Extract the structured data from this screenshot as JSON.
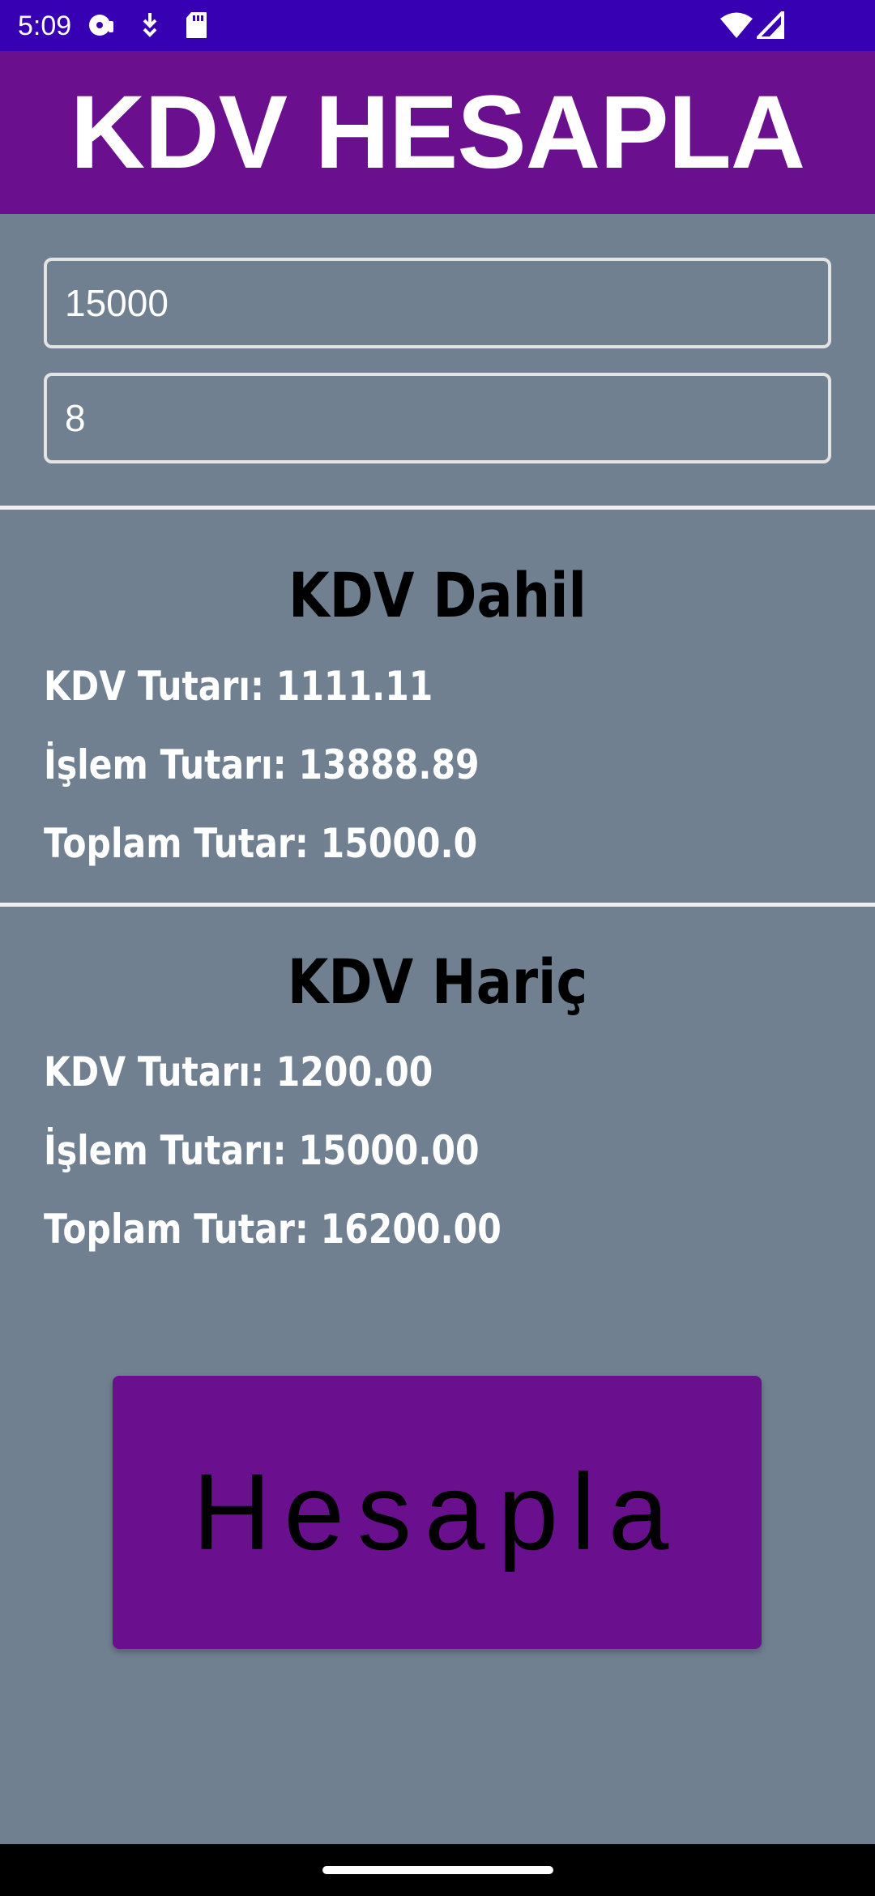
{
  "status_bar": {
    "time": "5:09",
    "icons": [
      "media-icon",
      "download-icon",
      "sd-card-icon",
      "wifi-icon",
      "signal-icon"
    ]
  },
  "app_bar": {
    "title": "KDV HESAPLA",
    "color": "#6A0F8E"
  },
  "inputs": {
    "amount_value": "15000",
    "rate_value": "8"
  },
  "kdv_dahil": {
    "title": "KDV Dahil",
    "kdv_amount": "KDV Tutarı: 1111.11",
    "transaction_amount": "İşlem Tutarı: 13888.89",
    "total_amount": "Toplam Tutar: 15000.0"
  },
  "kdv_haric": {
    "title": "KDV Hariç",
    "kdv_amount": "KDV Tutarı: 1200.00",
    "transaction_amount": "İşlem Tutarı: 15000.00",
    "total_amount": "Toplam Tutar: 16200.00"
  },
  "button": {
    "label": "Hesapla"
  },
  "colors": {
    "status_bar": "#3700B3",
    "background": "#708090",
    "accent": "#6A0F8E"
  }
}
